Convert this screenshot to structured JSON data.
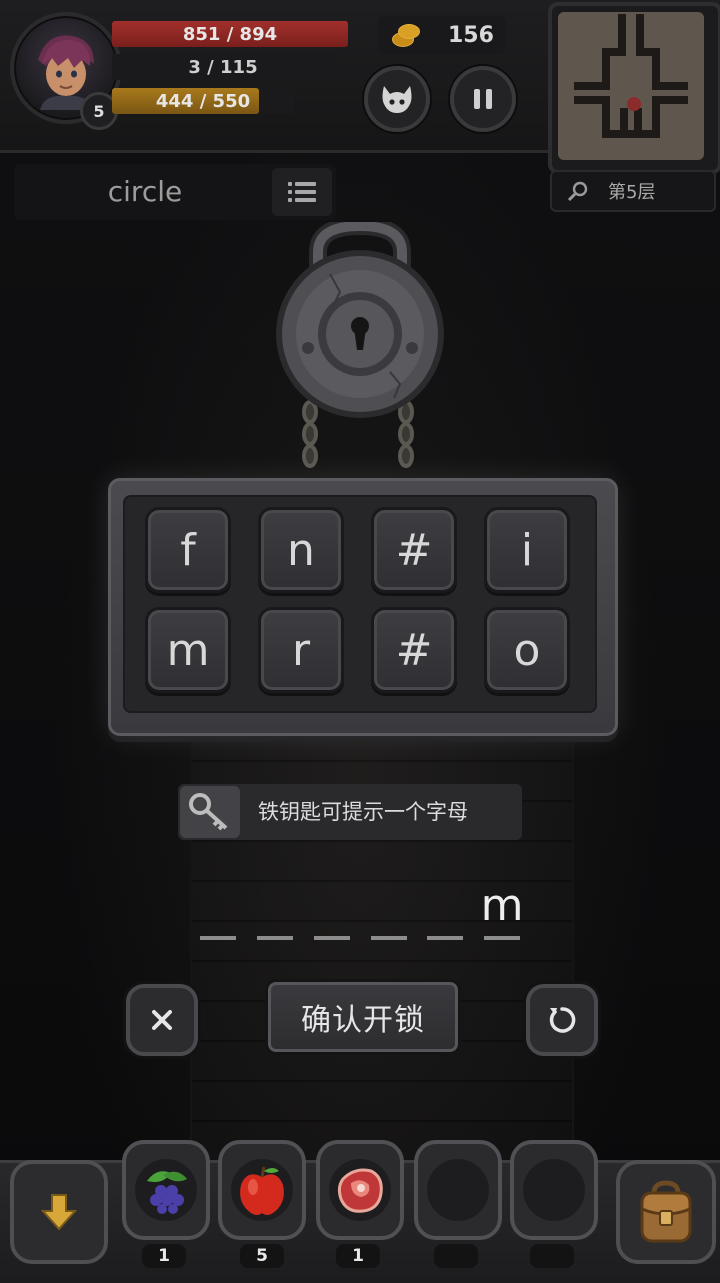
{
  "hud": {
    "level": "5",
    "hp": "851 / 894",
    "mp": "3 / 115",
    "xp": "444 / 550",
    "xp_fraction": 0.807,
    "coins": "156",
    "floor": "第5层"
  },
  "word_hint": "circle",
  "letters": [
    "f",
    "n",
    "#",
    "i",
    "m",
    "r",
    "#",
    "o"
  ],
  "hint_text": "铁钥匙可提示一个字母",
  "slots": [
    "",
    "",
    "",
    "",
    "",
    "m"
  ],
  "confirm_label": "确认开锁",
  "inventory": [
    {
      "icon": "blackberry-icon",
      "count": "1"
    },
    {
      "icon": "apple-icon",
      "count": "5"
    },
    {
      "icon": "meat-icon",
      "count": "1"
    },
    {
      "icon": "empty-slot",
      "count": ""
    },
    {
      "icon": "empty-slot",
      "count": ""
    }
  ]
}
